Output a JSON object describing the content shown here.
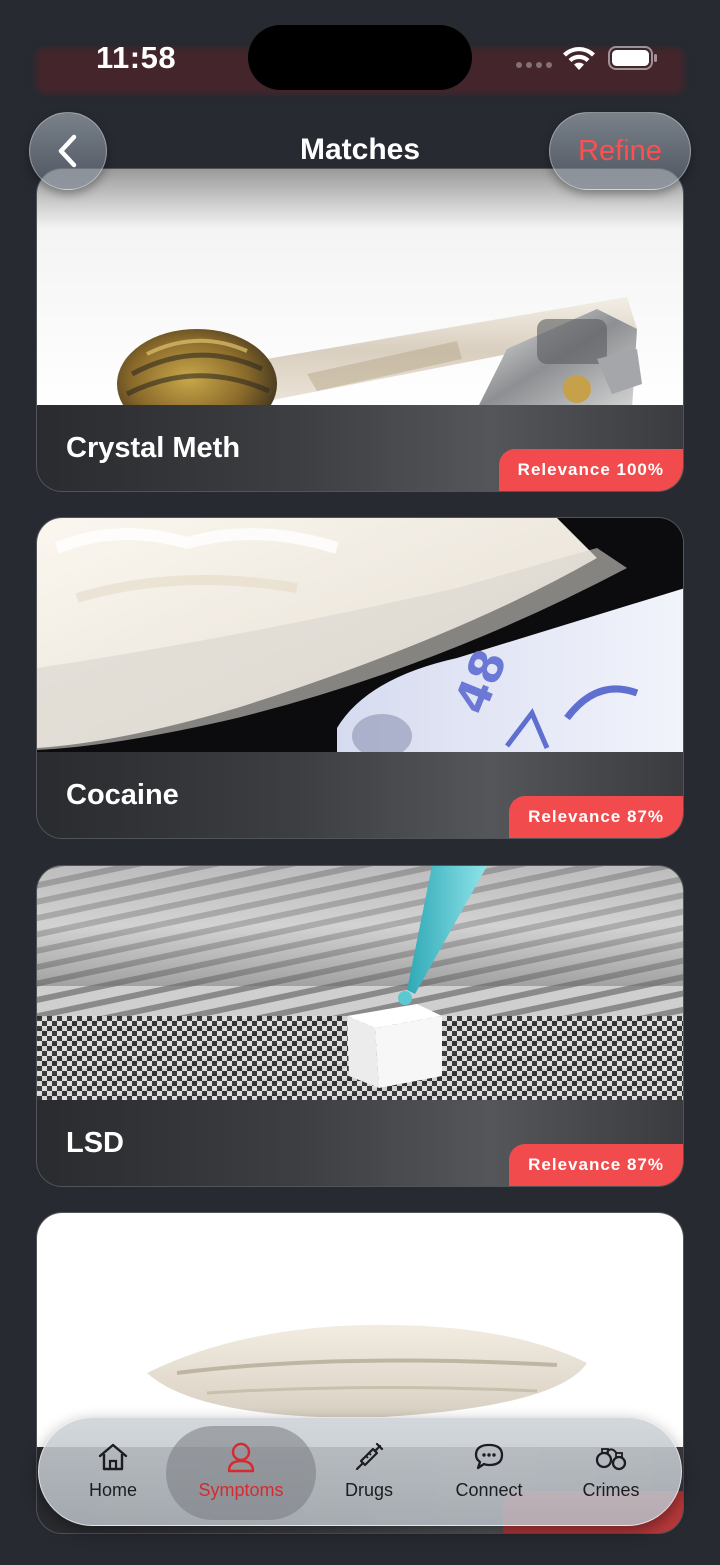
{
  "status_bar": {
    "time": "11:58"
  },
  "header": {
    "title": "Matches",
    "refine_label": "Refine"
  },
  "cards": [
    {
      "name": "Crystal Meth",
      "relevance": "Relevance 100%"
    },
    {
      "name": "Cocaine",
      "relevance": "Relevance 87%"
    },
    {
      "name": "LSD",
      "relevance": "Relevance 87%"
    },
    {
      "name": "",
      "relevance": ""
    }
  ],
  "tabs": [
    {
      "label": "Home",
      "icon": "home-icon"
    },
    {
      "label": "Symptoms",
      "icon": "person-icon",
      "active": true
    },
    {
      "label": "Drugs",
      "icon": "syringe-icon"
    },
    {
      "label": "Connect",
      "icon": "chat-bubble-icon"
    },
    {
      "label": "Crimes",
      "icon": "handcuffs-icon"
    }
  ],
  "colors": {
    "accent": "#f14b4d",
    "background": "#272a31",
    "active_tab": "#d62a2f"
  }
}
